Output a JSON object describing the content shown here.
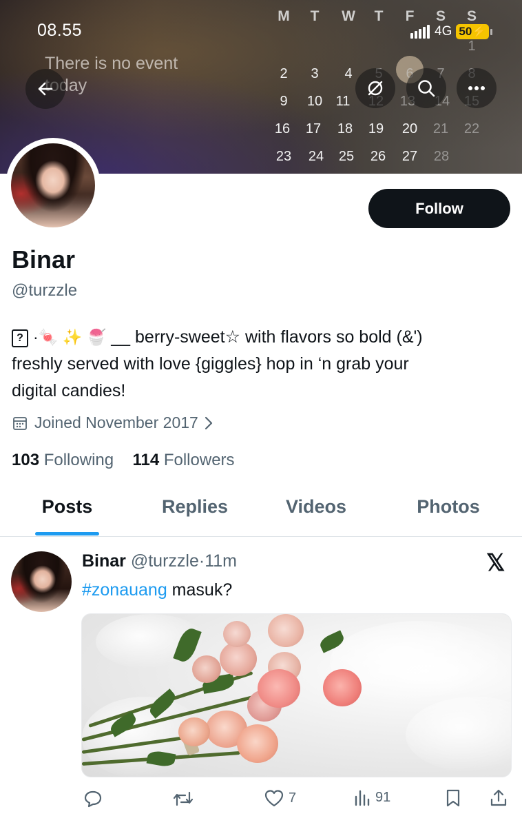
{
  "status_bar": {
    "time": "08.55",
    "network": "4G",
    "battery": "50"
  },
  "banner": {
    "event_text": "There is no event today",
    "calendar": {
      "weekdays": [
        "M",
        "T",
        "W",
        "T",
        "F",
        "S",
        "S"
      ],
      "rows": [
        [
          "",
          "",
          "",
          "",
          "",
          "",
          "1"
        ],
        [
          "2",
          "3",
          "4",
          "5",
          "6",
          "7",
          "8"
        ],
        [
          "9",
          "10",
          "11",
          "12",
          "13",
          "14",
          "15"
        ],
        [
          "16",
          "17",
          "18",
          "19",
          "20",
          "21",
          "22"
        ],
        [
          "23",
          "24",
          "25",
          "26",
          "27",
          "28",
          ""
        ]
      ],
      "today": "6"
    }
  },
  "profile": {
    "follow_label": "Follow",
    "display_name": "Binar",
    "handle": "@turzzle",
    "bio": {
      "box": "?",
      "emojis": "·🍬 ✨ 🍧",
      "line1_text": " __ berry-sweet☆ with flavors so bold (&')",
      "line2": "freshly served with love {giggles} hop in ‘n grab your",
      "line3": "digital candies!"
    },
    "joined": "Joined November 2017",
    "following_count": "103",
    "following_label": "Following",
    "followers_count": "114",
    "followers_label": "Followers"
  },
  "tabs": [
    {
      "label": "Posts",
      "active": true
    },
    {
      "label": "Replies",
      "active": false
    },
    {
      "label": "Videos",
      "active": false
    },
    {
      "label": "Photos",
      "active": false
    }
  ],
  "post": {
    "author": "Binar",
    "handle": "@turzzle",
    "separator": "·",
    "time": "11m",
    "hashtag": "#zonauang",
    "text": " masuk?",
    "likes": "7",
    "views": "91"
  },
  "colors": {
    "accent": "#1d9bf0",
    "follow_bg": "#0f1419",
    "muted": "#536471"
  },
  "icons": [
    "back-arrow-icon",
    "sync-off-icon",
    "search-icon",
    "more-icon",
    "calendar-icon",
    "chevron-right-icon",
    "x-logo-icon",
    "reply-icon",
    "repost-icon",
    "like-icon",
    "views-icon",
    "bookmark-icon",
    "share-icon"
  ]
}
